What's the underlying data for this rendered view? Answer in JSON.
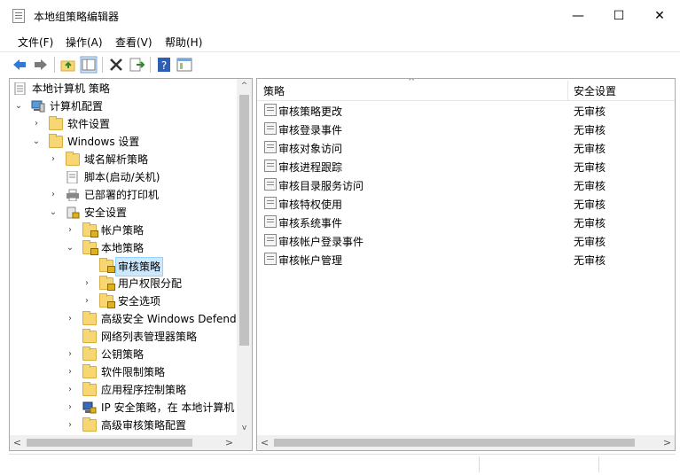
{
  "window": {
    "title": "本地组策略编辑器",
    "minimize": "—",
    "maximize": "☐",
    "close": "✕"
  },
  "menu": [
    "文件(F)",
    "操作(A)",
    "查看(V)",
    "帮助(H)"
  ],
  "toolbar": {
    "icons": [
      "back-arrow-icon",
      "forward-arrow-icon",
      "up-folder-icon",
      "show-hide-tree-icon",
      "delete-icon",
      "export-list-icon",
      "help-icon",
      "properties-icon"
    ]
  },
  "tree": {
    "root": "本地计算机 策略",
    "computer_config": "计算机配置",
    "software_settings": "软件设置",
    "windows_settings": "Windows 设置",
    "name_resolution": "域名解析策略",
    "scripts": "脚本(启动/关机)",
    "printers": "已部署的打印机",
    "security_settings": "安全设置",
    "account_policies": "帐户策略",
    "local_policies": "本地策略",
    "audit_policy": "审核策略",
    "user_rights": "用户权限分配",
    "security_options": "安全选项",
    "defender_firewall": "高级安全 Windows Defende",
    "network_list": "网络列表管理器策略",
    "public_key": "公钥策略",
    "software_restriction": "软件限制策略",
    "app_control": "应用程序控制策略",
    "ip_security": "IP 安全策略，在 本地计算机",
    "advanced_audit": "高级审核策略配置"
  },
  "list": {
    "col_policy": "策略",
    "col_setting": "安全设置",
    "sort_indicator": "^",
    "rows": [
      {
        "policy": "审核策略更改",
        "setting": "无审核"
      },
      {
        "policy": "审核登录事件",
        "setting": "无审核"
      },
      {
        "policy": "审核对象访问",
        "setting": "无审核"
      },
      {
        "policy": "审核进程跟踪",
        "setting": "无审核"
      },
      {
        "policy": "审核目录服务访问",
        "setting": "无审核"
      },
      {
        "policy": "审核特权使用",
        "setting": "无审核"
      },
      {
        "policy": "审核系统事件",
        "setting": "无审核"
      },
      {
        "policy": "审核帐户登录事件",
        "setting": "无审核"
      },
      {
        "policy": "审核帐户管理",
        "setting": "无审核"
      }
    ]
  },
  "scroll": {
    "left": "<",
    "right": ">",
    "up": "^",
    "down": "v"
  }
}
